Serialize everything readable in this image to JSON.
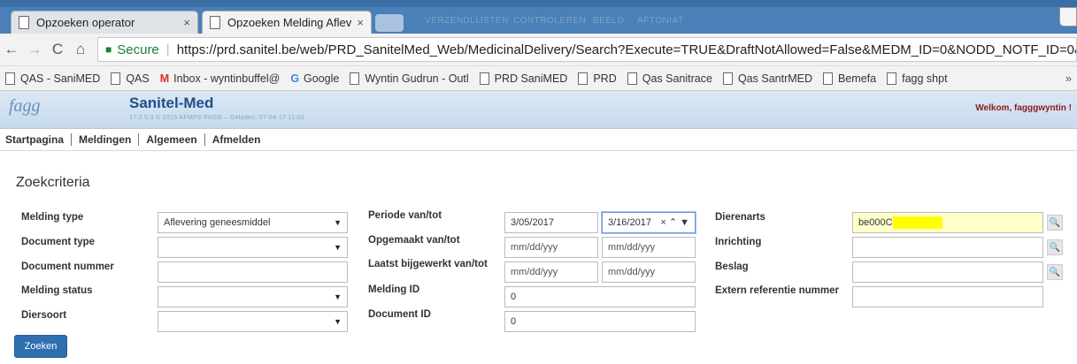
{
  "browser": {
    "tabs": [
      {
        "label": "Opzoeken operator",
        "close": "×"
      },
      {
        "label": "Opzoeken Melding Aflev",
        "close": "×"
      }
    ],
    "background_tab_text": [
      "VERZENDLIJSTEN",
      "CONTROLEREN",
      "BEELD",
      "AFTONIAT"
    ],
    "nav": {
      "back": "←",
      "forward": "→",
      "reload": "C",
      "home": "⌂"
    },
    "secure_label": "Secure",
    "url": "https://prd.sanitel.be/web/PRD_SanitelMed_Web/MedicinalDelivery/Search?Execute=TRUE&DraftNotAllowed=False&MEDM_ID=0&NODD_NOTF_ID=0&NOT",
    "bookmarks": [
      {
        "label": "QAS - SaniMED",
        "icon": "page-icon"
      },
      {
        "label": "QAS",
        "icon": "page-icon"
      },
      {
        "label": "Inbox - wyntinbuffel@",
        "icon": "gmail-icon"
      },
      {
        "label": "Google",
        "icon": "google-icon"
      },
      {
        "label": "Wyntin Gudrun - Outl",
        "icon": "outlook-icon"
      },
      {
        "label": "PRD SaniMED",
        "icon": "page-icon"
      },
      {
        "label": "PRD",
        "icon": "page-icon"
      },
      {
        "label": "Qas Sanitrace",
        "icon": "page-icon"
      },
      {
        "label": "Qas SantrMED",
        "icon": "page-icon"
      },
      {
        "label": "Bemefa",
        "icon": "page-icon"
      },
      {
        "label": "fagg shpt",
        "icon": "page-icon"
      }
    ],
    "bookmarks_more": "»"
  },
  "app": {
    "logo_text": "fagg",
    "name": "Sanitel-Med",
    "version": "17.2.5.0 © 2015 AFMPS-FAGG – Geladen: 07-04-17 11:03",
    "welcome": "Welkom, fagggwyntin !",
    "menu": [
      "Startpagina",
      "Meldingen",
      "Algemeen",
      "Afmelden"
    ]
  },
  "search": {
    "title": "Zoekcriteria",
    "col1": [
      {
        "label": "Melding type",
        "value": "Aflevering geneesmiddel",
        "type": "select"
      },
      {
        "label": "Document type",
        "value": "",
        "type": "select"
      },
      {
        "label": "Document nummer",
        "value": "",
        "type": "text"
      },
      {
        "label": "Melding status",
        "value": "",
        "type": "select"
      },
      {
        "label": "Diersoort",
        "value": "",
        "type": "select"
      }
    ],
    "col2": {
      "periode_label": "Periode van/tot",
      "periode_from": "3/05/2017",
      "periode_to": "3/16/2017",
      "date_controls": "× ⌃ ▼",
      "opgemaakt_label": "Opgemaakt van/tot",
      "bijgewerkt_label": "Laatst bijgewerkt van/tot",
      "date_placeholder": "mm/dd/yyy",
      "melding_id_label": "Melding ID",
      "melding_id_value": "0",
      "document_id_label": "Document ID",
      "document_id_value": "0"
    },
    "col3": {
      "dierenarts_label": "Dierenarts",
      "dierenarts_value": "be000C",
      "inrichting_label": "Inrichting",
      "beslag_label": "Beslag",
      "extern_label": "Extern referentie nummer"
    },
    "search_button": "Zoeken",
    "lookup_icon": "🔍"
  }
}
